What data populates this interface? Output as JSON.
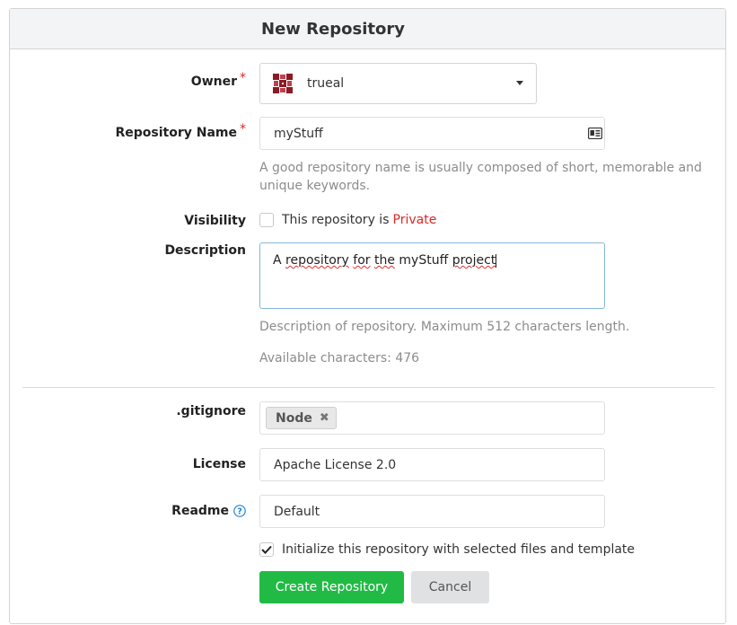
{
  "header": {
    "title": "New Repository"
  },
  "owner": {
    "label": "Owner",
    "required": "*",
    "value": "trueal"
  },
  "repo_name": {
    "label": "Repository Name",
    "required": "*",
    "value": "myStuff",
    "help_line1": "A good repository name is usually composed of short, memorable and",
    "help_line2": "unique keywords."
  },
  "visibility": {
    "label": "Visibility",
    "text": "This repository is ",
    "private_word": "Private",
    "checked": false
  },
  "description": {
    "label": "Description",
    "value_words": [
      "A ",
      "repository",
      " ",
      "for",
      " ",
      "the",
      " myStuff ",
      "project"
    ],
    "help": "Description of repository. Maximum 512 characters length.",
    "available": "Available characters: 476"
  },
  "gitignore": {
    "label": ".gitignore",
    "tag": "Node",
    "remove_icon": "close-icon"
  },
  "license": {
    "label": "License",
    "value": "Apache License 2.0"
  },
  "readme": {
    "label": "Readme",
    "value": "Default",
    "help_icon": "question-circle-icon"
  },
  "init": {
    "label": "Initialize this repository with selected files and template",
    "checked": true
  },
  "actions": {
    "create_label": "Create Repository",
    "cancel_label": "Cancel"
  },
  "colors": {
    "accent_green": "#21ba45",
    "required_red": "#db2828",
    "focus_border": "#85b7d9"
  }
}
